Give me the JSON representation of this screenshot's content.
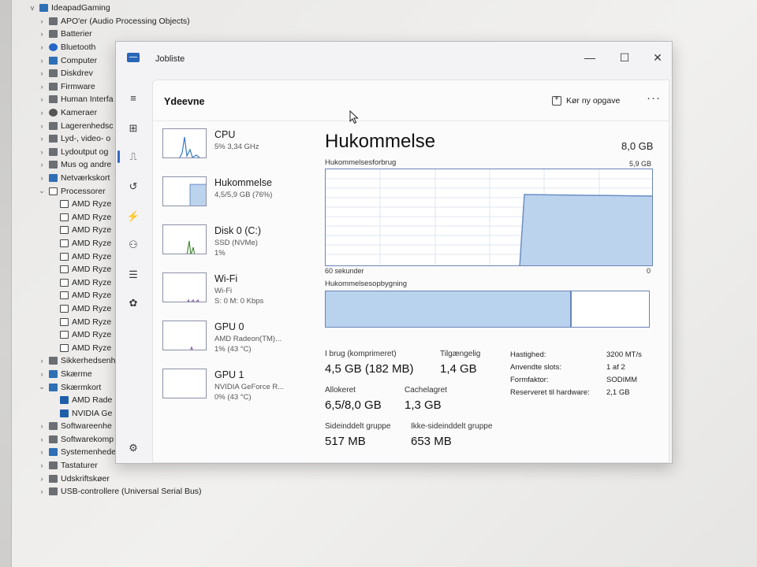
{
  "device_manager": {
    "root": "IdeapadGaming",
    "items": [
      {
        "chev": ">",
        "icon": "gray",
        "label": "APO'er (Audio Processing Objects)"
      },
      {
        "chev": ">",
        "icon": "gray",
        "label": "Batterier"
      },
      {
        "chev": ">",
        "icon": "bt",
        "label": "Bluetooth"
      },
      {
        "chev": ">",
        "icon": "blue",
        "label": "Computer"
      },
      {
        "chev": ">",
        "icon": "gray",
        "label": "Diskdrev"
      },
      {
        "chev": ">",
        "icon": "gray",
        "label": "Firmware"
      },
      {
        "chev": ">",
        "icon": "gray",
        "label": "Human Interfa"
      },
      {
        "chev": ">",
        "icon": "cam",
        "label": "Kameraer"
      },
      {
        "chev": ">",
        "icon": "gray",
        "label": "Lagerenhedsc"
      },
      {
        "chev": ">",
        "icon": "gray",
        "label": "Lyd-, video- o"
      },
      {
        "chev": ">",
        "icon": "gray",
        "label": "Lydoutput og"
      },
      {
        "chev": ">",
        "icon": "gray",
        "label": "Mus og andre"
      },
      {
        "chev": ">",
        "icon": "blue",
        "label": "Netværkskort"
      },
      {
        "chev": "v",
        "icon": "box",
        "label": "Processorer"
      }
    ],
    "processors": [
      "AMD Ryze",
      "AMD Ryze",
      "AMD Ryze",
      "AMD Ryze",
      "AMD Ryze",
      "AMD Ryze",
      "AMD Ryze",
      "AMD Ryze",
      "AMD Ryze",
      "AMD Ryze",
      "AMD Ryze",
      "AMD Ryze"
    ],
    "items_after": [
      {
        "chev": ">",
        "icon": "gray",
        "label": "Sikkerhedsenh"
      },
      {
        "chev": ">",
        "icon": "blue",
        "label": "Skærme"
      },
      {
        "chev": "v",
        "icon": "blue",
        "label": "Skærmkort"
      }
    ],
    "gpus": [
      "AMD Rade",
      "NVIDIA Ge"
    ],
    "items_end": [
      {
        "chev": ">",
        "icon": "gray",
        "label": "Softwareenhe"
      },
      {
        "chev": ">",
        "icon": "gray",
        "label": "Softwarekomp"
      },
      {
        "chev": ">",
        "icon": "blue",
        "label": "Systemenhede"
      },
      {
        "chev": ">",
        "icon": "gray",
        "label": "Tastaturer"
      },
      {
        "chev": ">",
        "icon": "gray",
        "label": "Udskriftskøer"
      },
      {
        "chev": ">",
        "icon": "gray",
        "label": "USB-controllere (Universal Serial Bus)"
      }
    ]
  },
  "task_manager": {
    "window_title": "Jobliste",
    "page_title": "Ydeevne",
    "run_task_label": "Kør ny opgave",
    "more_label": "···",
    "perf_items": [
      {
        "name": "CPU",
        "sub1": "5% 3,34 GHz",
        "sub2": ""
      },
      {
        "name": "Hukommelse",
        "sub1": "4,5/5,9 GB (76%)",
        "sub2": ""
      },
      {
        "name": "Disk 0 (C:)",
        "sub1": "SSD (NVMe)",
        "sub2": "1%"
      },
      {
        "name": "Wi-Fi",
        "sub1": "Wi-Fi",
        "sub2": "S: 0 M: 0 Kbps"
      },
      {
        "name": "GPU 0",
        "sub1": "AMD Radeon(TM)...",
        "sub2": "1% (43 °C)"
      },
      {
        "name": "GPU 1",
        "sub1": "NVIDIA GeForce R...",
        "sub2": "0% (43 °C)"
      }
    ],
    "memory_used_fraction": 0.76,
    "details": {
      "title": "Hukommelse",
      "total": "8,0 GB",
      "usage_label": "Hukommelsesforbrug",
      "usage_max": "5,9 GB",
      "time_label": "60 sekunder",
      "zero_label": "0",
      "composition_label": "Hukommelsesopbygning",
      "stats": [
        {
          "label": "I brug (komprimeret)",
          "value": "4,5 GB (182 MB)"
        },
        {
          "label": "Tilgængelig",
          "value": "1,4 GB"
        },
        {
          "label": "Allokeret",
          "value": "6,5/8,0 GB"
        },
        {
          "label": "Cachelagret",
          "value": "1,3 GB"
        },
        {
          "label": "Sideinddelt gruppe",
          "value": "517 MB"
        },
        {
          "label": "Ikke-sideinddelt gruppe",
          "value": "653 MB"
        }
      ],
      "props": [
        {
          "key": "Hastighed:",
          "value": "3200 MT/s"
        },
        {
          "key": "Anvendte slots:",
          "value": "1 af 2"
        },
        {
          "key": "Formfaktor:",
          "value": "SODIMM"
        },
        {
          "key": "Reserveret til hardware:",
          "value": "2,1 GB"
        }
      ]
    }
  }
}
